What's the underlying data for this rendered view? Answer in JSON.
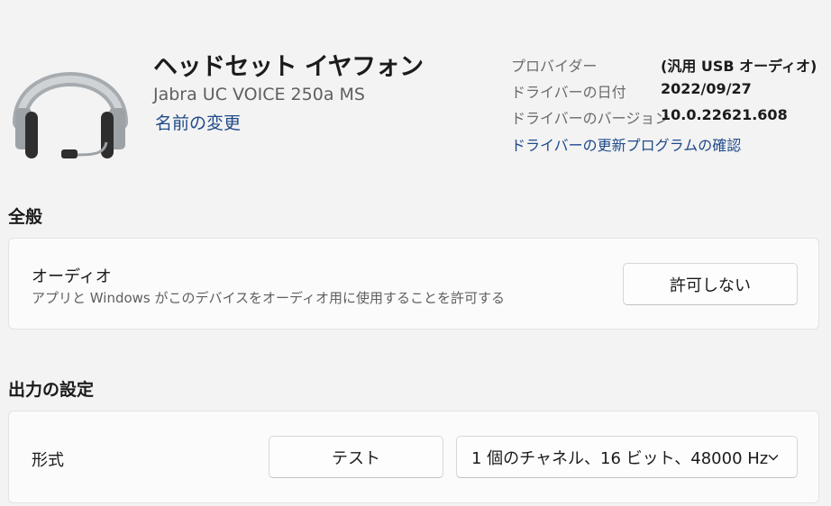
{
  "device": {
    "name": "ヘッドセット イヤフォン",
    "model": "Jabra UC VOICE 250a MS",
    "rename_link": "名前の変更",
    "icon": "headset-icon"
  },
  "driver_info": {
    "provider_label": "プロバイダー",
    "provider_value": "(汎用 USB オーディオ)",
    "date_label": "ドライバーの日付",
    "date_value": "2022/09/27",
    "version_label": "ドライバーのバージョン",
    "version_value": "10.0.22621.608",
    "update_link": "ドライバーの更新プログラムの確認"
  },
  "general": {
    "heading": "全般",
    "audio": {
      "title": "オーディオ",
      "description": "アプリと Windows がこのデバイスをオーディオ用に使用することを許可する",
      "button_label": "許可しない"
    }
  },
  "output": {
    "heading": "出力の設定",
    "format": {
      "label": "形式",
      "test_button": "テスト",
      "selected": "1 個のチャネル、16 ビット、48000 Hz",
      "dropdown_icon": "chevron-down-icon"
    }
  },
  "colors": {
    "background": "#f3f3f3",
    "card": "#fbfbfb",
    "link": "#1f4a8a"
  }
}
